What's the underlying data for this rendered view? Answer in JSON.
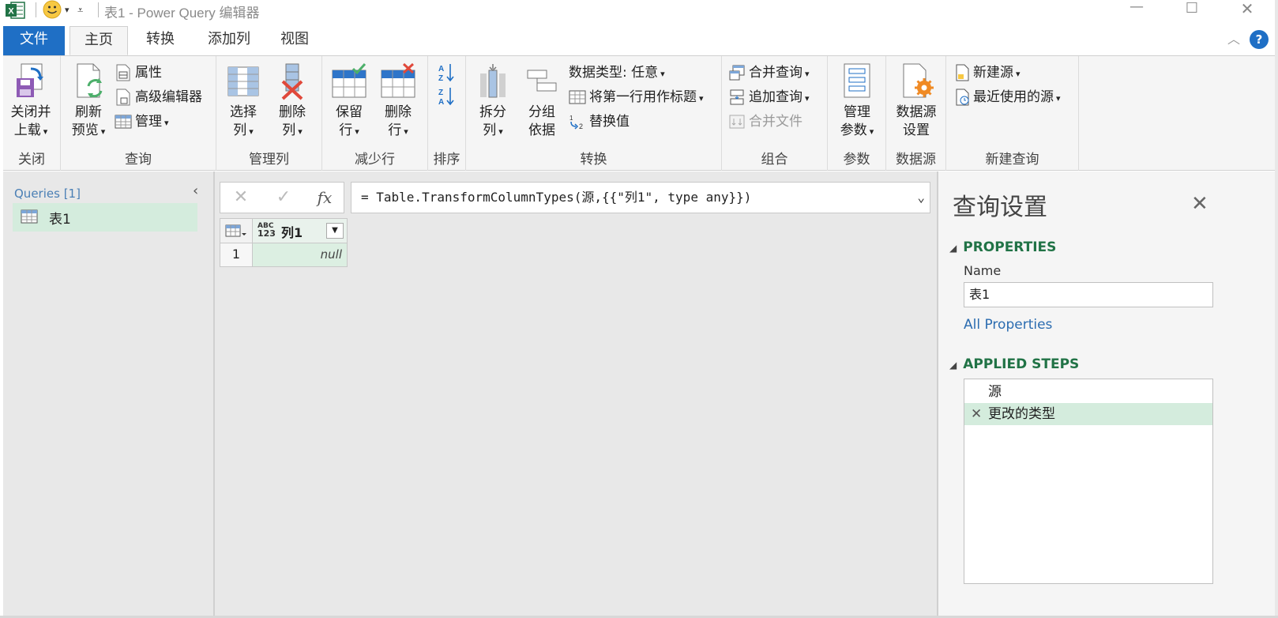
{
  "titlebar": {
    "title": "表1 - Power Query 编辑器",
    "excel_badge": "X"
  },
  "tabs": [
    {
      "label": "文件"
    },
    {
      "label": "主页"
    },
    {
      "label": "转换"
    },
    {
      "label": "添加列"
    },
    {
      "label": "视图"
    }
  ],
  "help_label": "?",
  "ribbon": {
    "close": {
      "group": "关闭",
      "close_load": [
        "关闭并",
        "上载"
      ]
    },
    "query": {
      "group": "查询",
      "refresh": [
        "刷新",
        "预览"
      ],
      "properties": "属性",
      "advanced": "高级编辑器",
      "manage": "管理"
    },
    "manage_cols": {
      "group": "管理列",
      "choose": [
        "选择",
        "列"
      ],
      "remove": [
        "删除",
        "列"
      ]
    },
    "reduce_rows": {
      "group": "减少行",
      "keep": [
        "保留",
        "行"
      ],
      "remove": [
        "删除",
        "行"
      ]
    },
    "sort": {
      "group": "排序"
    },
    "transform": {
      "group": "转换",
      "split": [
        "拆分",
        "列"
      ],
      "groupby": [
        "分组",
        "依据"
      ],
      "datatype": "数据类型: 任意",
      "first_row": "将第一行用作标题",
      "replace": "替换值"
    },
    "combine": {
      "group": "组合",
      "merge": "合并查询",
      "append": "追加查询",
      "combine_files": "合并文件"
    },
    "params": {
      "group": "参数",
      "manage": [
        "管理",
        "参数"
      ]
    },
    "datasource": {
      "group": "数据源",
      "settings": [
        "数据源",
        "设置"
      ]
    },
    "newquery": {
      "group": "新建查询",
      "new_source": "新建源",
      "recent": "最近使用的源"
    }
  },
  "queries": {
    "title": "Queries [1]",
    "items": [
      {
        "label": "表1"
      }
    ]
  },
  "formula": {
    "text": "= Table.TransformColumnTypes(源,{{\"列1\", type any}})"
  },
  "grid": {
    "column": {
      "type_top": "ABC",
      "type_bottom": "123",
      "name": "列1"
    },
    "rows": [
      {
        "num": "1",
        "value": "null"
      }
    ]
  },
  "settings": {
    "title": "查询设置",
    "properties_title": "PROPERTIES",
    "name_label": "Name",
    "name_value": "表1",
    "all_properties": "All Properties",
    "steps_title": "APPLIED STEPS",
    "steps": [
      {
        "label": "源"
      },
      {
        "label": "更改的类型"
      }
    ]
  },
  "colors": {
    "accent": "#1f6fc5",
    "green": "#217346",
    "selection": "#d4ecdd"
  }
}
